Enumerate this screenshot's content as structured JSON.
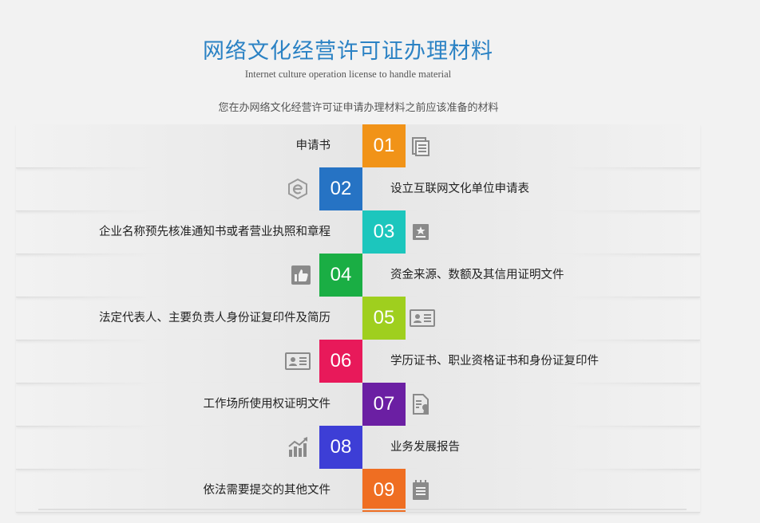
{
  "header": {
    "title": "网络文化经营许可证办理材料",
    "subtitle": "Internet culture operation license to handle material",
    "description": "您在办网络文化经营许可证申请办理材料之前应该准备的材料"
  },
  "items": [
    {
      "num": "01",
      "label": "申请书",
      "color": "#f19318",
      "icon": "documents-icon"
    },
    {
      "num": "02",
      "label": "设立互联网文化单位申请表",
      "color": "#2673c4",
      "icon": "e-logo-icon"
    },
    {
      "num": "03",
      "label": "企业名称预先核准通知书或者营业执照和章程",
      "color": "#1cc6bd",
      "icon": "star-card-icon"
    },
    {
      "num": "04",
      "label": "资金来源、数额及其信用证明文件",
      "color": "#1aae44",
      "icon": "thumbs-up-icon"
    },
    {
      "num": "05",
      "label": "法定代表人、主要负责人身份证复印件及简历",
      "color": "#9fcf1e",
      "icon": "id-card-icon"
    },
    {
      "num": "06",
      "label": "学历证书、职业资格证书和身份证复印件",
      "color": "#e8195a",
      "icon": "id-card-icon"
    },
    {
      "num": "07",
      "label": "工作场所使用权证明文件",
      "color": "#6b1fa3",
      "icon": "certificate-icon"
    },
    {
      "num": "08",
      "label": "业务发展报告",
      "color": "#3d3ed6",
      "icon": "bar-chart-icon"
    },
    {
      "num": "09",
      "label": "依法需要提交的其他文件",
      "color": "#ef6e22",
      "icon": "notepad-icon"
    }
  ]
}
